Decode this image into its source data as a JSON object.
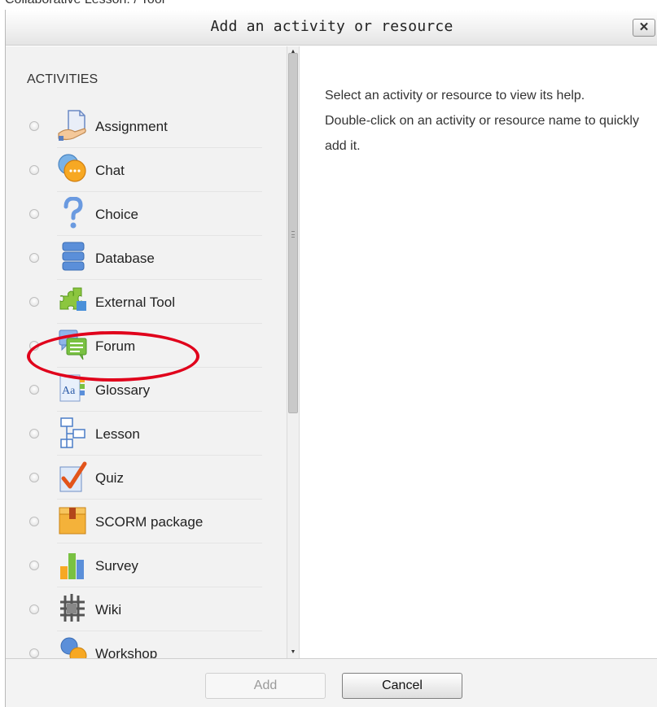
{
  "background_strip_text": "Collaborative Lesson: / Tool",
  "dialog": {
    "title": "Add an activity or resource",
    "close_label": "✕"
  },
  "activities": {
    "heading": "ACTIVITIES",
    "items": [
      {
        "label": "Assignment",
        "icon": "assignment-icon"
      },
      {
        "label": "Chat",
        "icon": "chat-icon"
      },
      {
        "label": "Choice",
        "icon": "choice-icon"
      },
      {
        "label": "Database",
        "icon": "database-icon"
      },
      {
        "label": "External Tool",
        "icon": "external-tool-icon"
      },
      {
        "label": "Forum",
        "icon": "forum-icon"
      },
      {
        "label": "Glossary",
        "icon": "glossary-icon"
      },
      {
        "label": "Lesson",
        "icon": "lesson-icon"
      },
      {
        "label": "Quiz",
        "icon": "quiz-icon"
      },
      {
        "label": "SCORM package",
        "icon": "scorm-package-icon"
      },
      {
        "label": "Survey",
        "icon": "survey-icon"
      },
      {
        "label": "Wiki",
        "icon": "wiki-icon"
      },
      {
        "label": "Workshop",
        "icon": "workshop-icon"
      }
    ]
  },
  "help": {
    "line1": "Select an activity or resource to view its help.",
    "line2": "Double-click on an activity or resource name to quickly add it."
  },
  "footer": {
    "add_label": "Add",
    "cancel_label": "Cancel"
  },
  "colors": {
    "highlight": "#e0001b",
    "panel_bg": "#f2f2f2"
  }
}
